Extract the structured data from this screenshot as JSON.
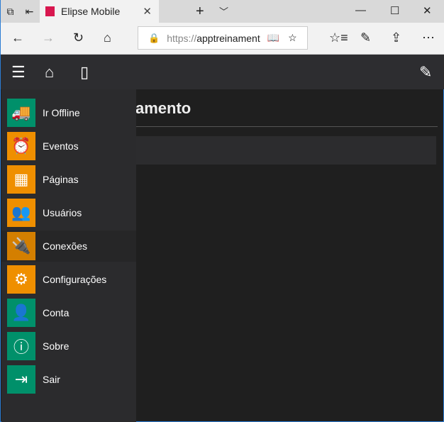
{
  "browser": {
    "tab_title": "Elipse Mobile",
    "url_protocol": "https://",
    "url_host": "apptreinament"
  },
  "page": {
    "title": "amento"
  },
  "colors": {
    "green": "#00906a",
    "orange": "#ef8f00",
    "orange_active": "#d47f00",
    "appbar": "#2d2d30"
  },
  "menu": [
    {
      "label": "Ir Offline",
      "icon": "truck-icon",
      "color": "#00906a",
      "glyph": "🚚"
    },
    {
      "label": "Eventos",
      "icon": "alarm-clock-icon",
      "color": "#ef8f00",
      "glyph": "⏰"
    },
    {
      "label": "Páginas",
      "icon": "pages-icon",
      "color": "#ef8f00",
      "glyph": "▦"
    },
    {
      "label": "Usuários",
      "icon": "users-icon",
      "color": "#ef8f00",
      "glyph": "👥"
    },
    {
      "label": "Conexões",
      "icon": "plug-icon",
      "color": "#d47f00",
      "glyph": "🔌"
    },
    {
      "label": "Configurações",
      "icon": "gear-icon",
      "color": "#ef8f00",
      "glyph": "⚙"
    },
    {
      "label": "Conta",
      "icon": "user-icon",
      "color": "#00906a",
      "glyph": "👤"
    },
    {
      "label": "Sobre",
      "icon": "info-icon",
      "color": "#00906a",
      "glyph": "ⓘ"
    },
    {
      "label": "Sair",
      "icon": "exit-door-icon",
      "color": "#00906a",
      "glyph": "⇥"
    }
  ]
}
